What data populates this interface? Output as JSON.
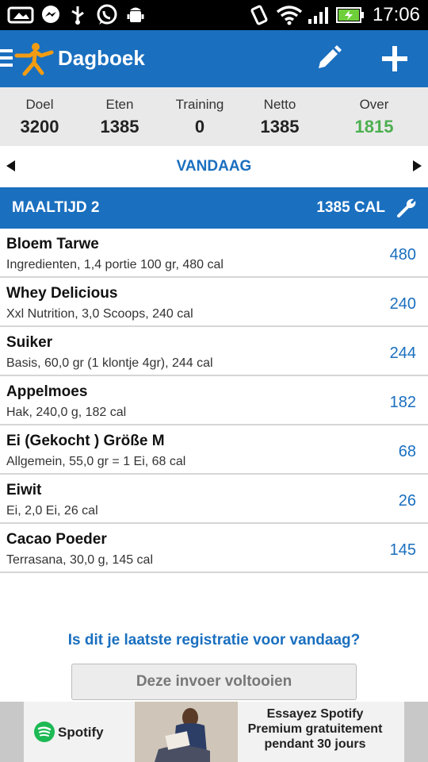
{
  "status_bar": {
    "time": "17:06"
  },
  "app_bar": {
    "title": "Dagboek"
  },
  "summary": [
    {
      "label": "Doel",
      "value": "3200"
    },
    {
      "label": "Eten",
      "value": "1385"
    },
    {
      "label": "Training",
      "value": "0"
    },
    {
      "label": "Netto",
      "value": "1385"
    },
    {
      "label": "Over",
      "value": "1815"
    }
  ],
  "date_nav": {
    "label": "VANDAAG"
  },
  "meal": {
    "name": "MAALTIJD 2",
    "calories": "1385 CAL"
  },
  "foods": [
    {
      "name": "Bloem Tarwe",
      "detail": "Ingredienten, 1,4 portie 100 gr, 480 cal",
      "cal": "480"
    },
    {
      "name": "Whey Delicious",
      "detail": "Xxl Nutrition, 3,0 Scoops, 240 cal",
      "cal": "240"
    },
    {
      "name": "Suiker",
      "detail": "Basis, 60,0 gr (1 klontje 4gr), 244 cal",
      "cal": "244"
    },
    {
      "name": "Appelmoes",
      "detail": "Hak, 240,0 g, 182 cal",
      "cal": "182"
    },
    {
      "name": "Ei (Gekocht ) Größe M",
      "detail": "Allgemein, 55,0 gr = 1 Ei, 68 cal",
      "cal": "68"
    },
    {
      "name": "Eiwit",
      "detail": "Ei, 2,0 Ei, 26 cal",
      "cal": "26"
    },
    {
      "name": "Cacao Poeder",
      "detail": "Terrasana, 30,0 g, 145 cal",
      "cal": "145"
    }
  ],
  "prompt": {
    "question": "Is dit je laatste registratie voor vandaag?",
    "button": "Deze invoer voltooien"
  },
  "ad": {
    "brand": "Spotify",
    "line1": "Essayez Spotify",
    "line2": "Premium gratuitement",
    "line3": "pendant 30 jours"
  },
  "colors": {
    "primary": "#1a6fbf",
    "remaining": "#4caf50",
    "summary_bg": "#e9e9e9"
  }
}
